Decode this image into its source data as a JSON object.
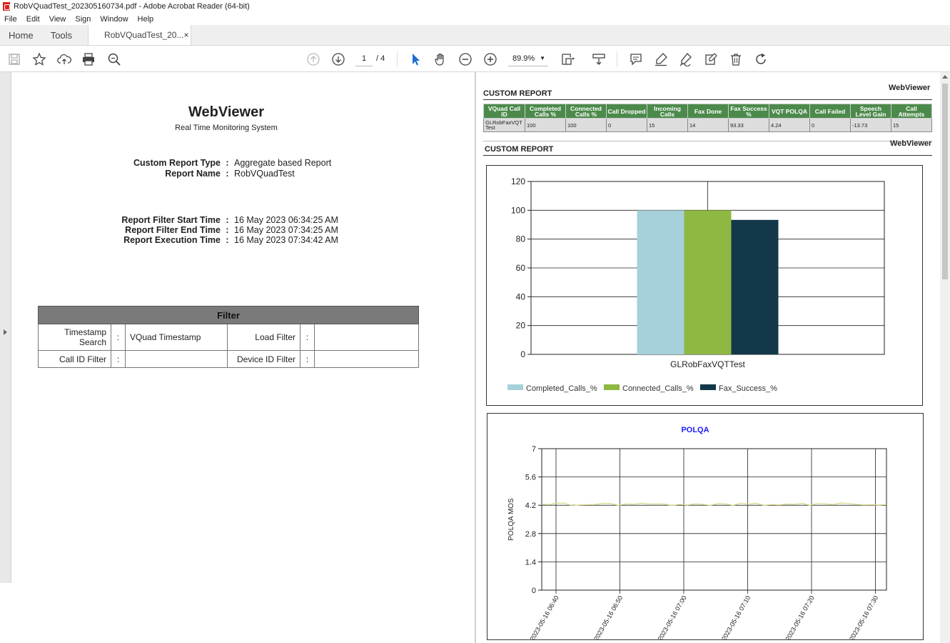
{
  "window": {
    "title": "RobVQuadTest_202305160734.pdf - Adobe Acrobat Reader (64-bit)"
  },
  "menu": [
    "File",
    "Edit",
    "View",
    "Sign",
    "Window",
    "Help"
  ],
  "tabs": {
    "home": "Home",
    "tools": "Tools",
    "document": "RobVQuadTest_20...",
    "close": "×"
  },
  "toolbar": {
    "page_current": "1",
    "page_total": "/ 4",
    "zoom": "89.9%",
    "icons": [
      "save-icon",
      "star-icon",
      "cloud-upload-icon",
      "print-icon",
      "search-zoom-icon",
      "page-up-icon",
      "page-down-icon",
      "select-arrow-icon",
      "hand-icon",
      "zoom-out-icon",
      "zoom-in-icon",
      "fit-page-icon",
      "scroll-mode-icon",
      "comment-icon",
      "highlight-icon",
      "sign-icon",
      "stamp-icon",
      "delete-icon",
      "rotate-icon"
    ]
  },
  "left_page": {
    "title": "WebViewer",
    "subtitle": "Real Time Monitoring System",
    "fields": [
      {
        "label": "Custom Report Type",
        "value": "Aggregate based Report"
      },
      {
        "label": "Report Name",
        "value": "RobVQuadTest"
      },
      {
        "label": "Report Filter Start Time",
        "value": "16 May 2023 06:34:25 AM"
      },
      {
        "label": "Report Filter End Time",
        "value": "16 May 2023 07:34:25 AM"
      },
      {
        "label": "Report Execution Time",
        "value": "16 May 2023 07:34:42 AM"
      }
    ],
    "colon": ":",
    "filter": {
      "header": "Filter",
      "row1": {
        "label1": "Timestamp Search",
        "value1": "VQuad Timestamp",
        "label2": "Load Filter",
        "value2": ""
      },
      "row2": {
        "label1": "Call ID Filter",
        "value1": "",
        "label2": "Device ID Filter",
        "value2": ""
      }
    }
  },
  "right_page": {
    "section1_title": "CUSTOM REPORT",
    "section1_brand": "WebViewer",
    "table": {
      "headers": [
        "VQuad Call ID",
        "Completed Calls %",
        "Connected Calls %",
        "Call Dropped",
        "Incoming Calls",
        "Fax Done",
        "Fax Success %",
        "VQT POLQA",
        "Call Failed",
        "Speech Level Gain",
        "Call Attempts"
      ],
      "rows": [
        [
          "GLRobFaxVQT Test",
          "100",
          "100",
          "0",
          "15",
          "14",
          "93.33",
          "4.24",
          "0",
          "-13.73",
          "15"
        ]
      ]
    },
    "section2_title": "CUSTOM REPORT",
    "section2_brand": "WebViewer"
  },
  "chart_data": [
    {
      "type": "bar",
      "title": "",
      "categories": [
        "GLRobFaxVQTTest"
      ],
      "series": [
        {
          "name": "Completed_Calls_%",
          "values": [
            100
          ],
          "color": "#a6d1da"
        },
        {
          "name": "Connected_Calls_%",
          "values": [
            100
          ],
          "color": "#8fb843"
        },
        {
          "name": "Fax_Success_%",
          "values": [
            93.33
          ],
          "color": "#13384a"
        }
      ],
      "ylim": [
        0,
        120
      ],
      "yticks": [
        "0",
        "20",
        "40",
        "60",
        "80",
        "100",
        "120"
      ],
      "grid": true,
      "legend": "bottom-left"
    },
    {
      "type": "line",
      "title": "POLQA",
      "title_color": "#1a1aff",
      "ylabel": "POLQA MOS",
      "ylim": [
        0,
        7
      ],
      "yticks": [
        "0",
        "1.4",
        "2.8",
        "4.2",
        "5.6",
        "7"
      ],
      "xticks": [
        "2023-05-16 06:40",
        "2023-05-16 06:50",
        "2023-05-16 07:00",
        "2023-05-16 07:10",
        "2023-05-16 07:20",
        "2023-05-16 07:30"
      ],
      "grid": true,
      "line_color": "#d9d98a",
      "series": [
        {
          "values": [
            4.25,
            4.24,
            4.31,
            4.3,
            4.18,
            4.22,
            4.23,
            4.24,
            4.3,
            4.29,
            4.2,
            4.27,
            4.25,
            4.3,
            4.26,
            4.27,
            4.26,
            4.19,
            4.25,
            4.21,
            4.27,
            4.25,
            4.2,
            4.28,
            4.27,
            4.2,
            4.31,
            4.26,
            4.3,
            4.2,
            4.24,
            4.22,
            4.26,
            4.25,
            4.3,
            4.2,
            4.29,
            4.27,
            4.24,
            4.31,
            4.29,
            4.25,
            4.22,
            4.23,
            4.21,
            4.24
          ]
        }
      ]
    }
  ]
}
